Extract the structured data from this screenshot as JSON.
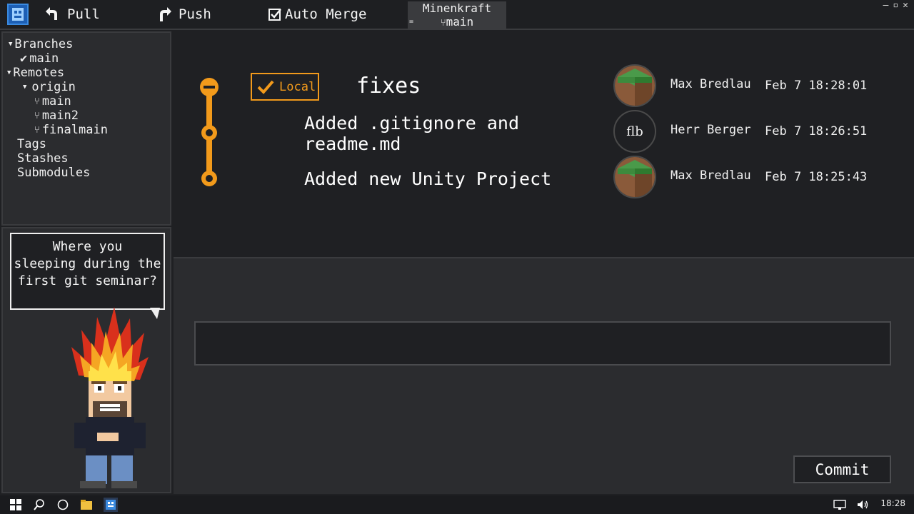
{
  "toolbar": {
    "pull_label": "Pull",
    "push_label": "Push",
    "auto_merge_label": "Auto Merge",
    "auto_merge_checked": true,
    "repo_name": "Minenkraft",
    "repo_branch": "main"
  },
  "window_controls": {
    "minimize": "–",
    "restore": "▫",
    "close": "✕"
  },
  "sidebar": {
    "branches_label": "Branches",
    "branches": [
      "main"
    ],
    "remotes_label": "Remotes",
    "remote_name": "origin",
    "remote_branches": [
      "main",
      "main2",
      "finalmain"
    ],
    "tags_label": "Tags",
    "stashes_label": "Stashes",
    "submodules_label": "Submodules"
  },
  "mascot": {
    "speech_line1": "Where you",
    "speech_line2": "sleeping during the",
    "speech_line3": "first git seminar?"
  },
  "history": {
    "local_badge": "Local",
    "commits": [
      {
        "message": "fixes",
        "author": "Max Bredlau",
        "date": "Feb 7 18:28:01",
        "avatar": "grass-block"
      },
      {
        "message_line1": "Added .gitignore and",
        "message_line2": "readme.md",
        "author": "Herr Berger",
        "date": "Feb 7 18:26:51",
        "avatar_text": "flb"
      },
      {
        "message": "Added new Unity Project",
        "author": "Max Bredlau",
        "date": "Feb 7 18:25:43",
        "avatar": "grass-block"
      }
    ],
    "graph_color": "#f29a1b"
  },
  "commit_panel": {
    "message_value": "",
    "commit_label": "Commit"
  },
  "taskbar": {
    "time": "18:28"
  }
}
